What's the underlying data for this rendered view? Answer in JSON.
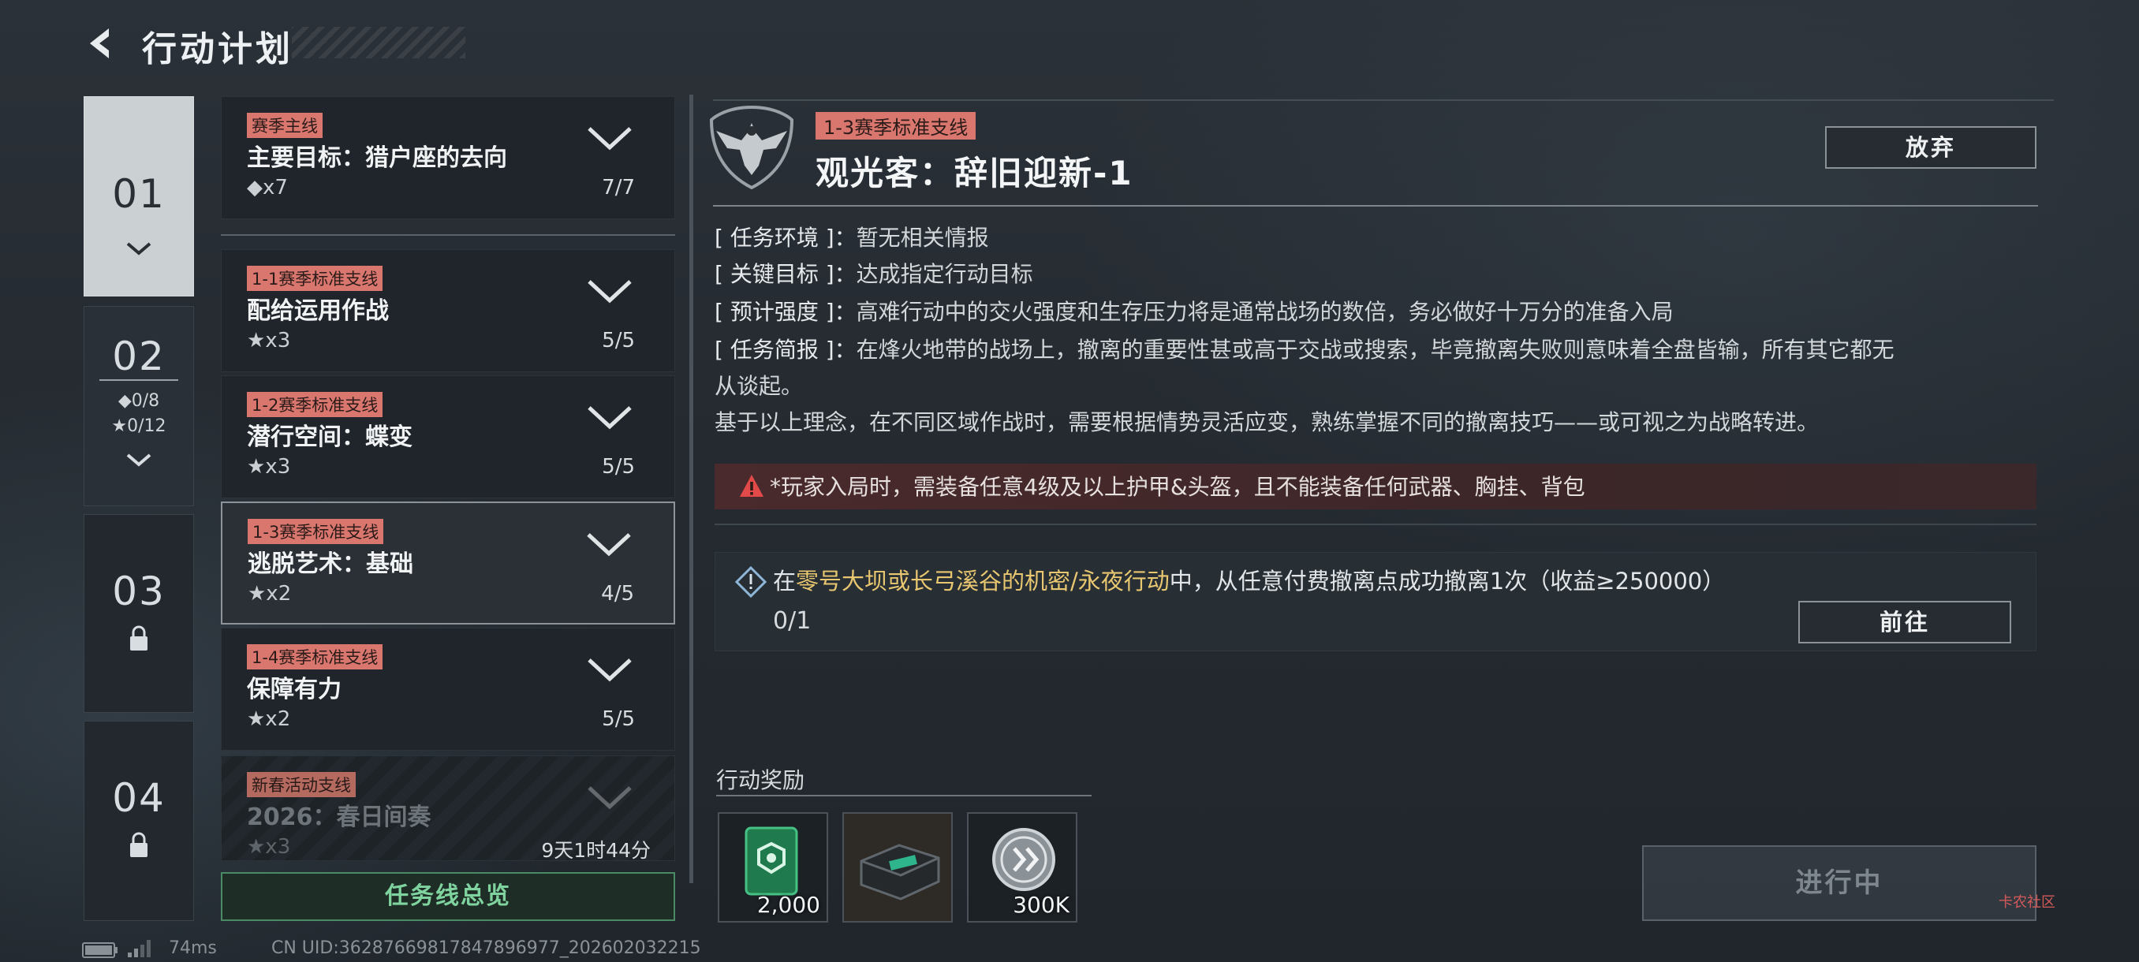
{
  "header": {
    "title": "行动计划"
  },
  "chapters": [
    {
      "num": "01",
      "active": true
    },
    {
      "num": "02",
      "diamond": "◆0/8",
      "star": "★0/12"
    },
    {
      "num": "03",
      "locked": true
    },
    {
      "num": "04",
      "locked": true
    }
  ],
  "tasks": [
    {
      "tag": "赛季主线",
      "name": "主要目标：猎户座的去向",
      "count": "◆x7",
      "progress": "7/7"
    },
    {
      "tag": "1-1赛季标准支线",
      "name": "配给运用作战",
      "count": "★x3",
      "progress": "5/5"
    },
    {
      "tag": "1-2赛季标准支线",
      "name": "潜行空间：蝶变",
      "count": "★x3",
      "progress": "5/5"
    },
    {
      "tag": "1-3赛季标准支线",
      "name": "逃脱艺术：基础",
      "count": "★x2",
      "progress": "4/5"
    },
    {
      "tag": "1-4赛季标准支线",
      "name": "保障有力",
      "count": "★x2",
      "progress": "5/5"
    },
    {
      "tag": "新春活动支线",
      "name": "2026：春日间奏",
      "count": "★x3",
      "progress": "9天1时44分"
    }
  ],
  "overview_button": "任务线总览",
  "detail": {
    "tag": "1-3赛季标准支线",
    "title": "观光客：辞旧迎新-1",
    "abandon": "放弃",
    "env_label": "[ 任务环境 ]：",
    "env": "暂无相关情报",
    "key_label": "[ 关键目标 ]：",
    "key": "达成指定行动目标",
    "intensity_label": "[ 预计强度 ]：",
    "intensity": "高难行动中的交火强度和生存压力将是通常战场的数倍，务必做好十万分的准备入局",
    "brief_label": "[ 任务简报 ]：",
    "brief_1": "在烽火地带的战场上，撤离的重要性甚或高于交战或搜索，毕竟撤离失败则意味着全盘皆输，所有其它都无",
    "brief_2": "从谈起。",
    "brief_3": "基于以上理念，在不同区域作战时，需要根据情势灵活应变，熟练掌握不同的撤离技巧——或可视之为战略转进。",
    "warning": "*玩家入局时，需装备任意4级及以上护甲&头盔，且不能装备任何武器、胸挂、背包",
    "objective_pre": "在",
    "objective_hl": "零号大坝或长弓溪谷的机密/永夜行动",
    "objective_post": "中，从任意付费撤离点成功撤离1次（收益≥250000）",
    "objective_progress": "0/1",
    "goto": "前往"
  },
  "rewards": {
    "title": "行动奖励",
    "items": [
      {
        "icon": "green-card-icon",
        "qty": "2,000"
      },
      {
        "icon": "supply-box-icon",
        "qty": ""
      },
      {
        "icon": "silver-coin-icon",
        "qty": "300K"
      }
    ]
  },
  "status_button": "进行中",
  "footer": {
    "ping": "74ms",
    "uid": "CN UID:36287669817847896977_202602032215"
  },
  "watermark": "卡农社区",
  "colors": {
    "tag": "#d9776f",
    "highlight": "#e8c770",
    "accent_green": "#7fd39e"
  }
}
